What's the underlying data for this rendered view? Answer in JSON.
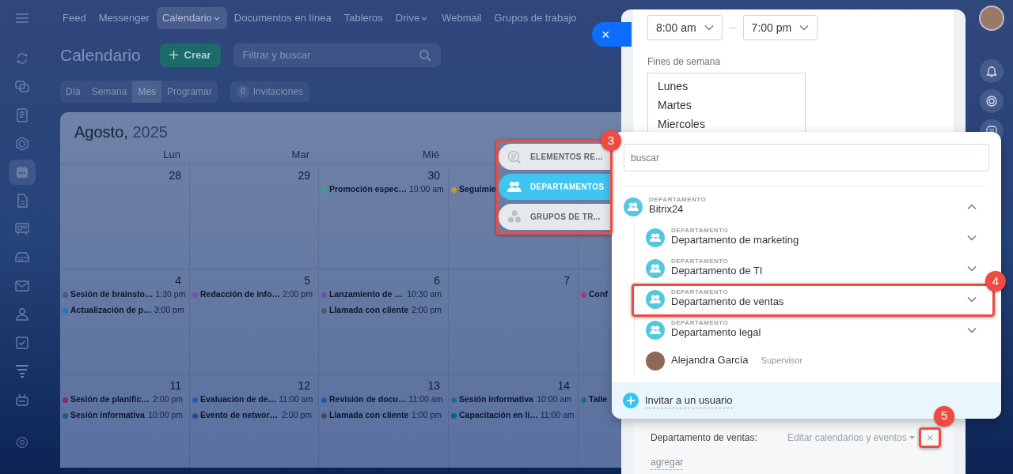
{
  "topnav": {
    "items": [
      {
        "label": "Feed",
        "selected": false,
        "dropdown": false
      },
      {
        "label": "Messenger",
        "selected": false,
        "dropdown": false
      },
      {
        "label": "Calendario",
        "selected": true,
        "dropdown": true
      },
      {
        "label": "Documentos en línea",
        "selected": false,
        "dropdown": false
      },
      {
        "label": "Tableros",
        "selected": false,
        "dropdown": false
      },
      {
        "label": "Drive",
        "selected": false,
        "dropdown": true
      },
      {
        "label": "Webmail",
        "selected": false,
        "dropdown": false
      },
      {
        "label": "Grupos de trabajo",
        "selected": false,
        "dropdown": false
      }
    ]
  },
  "sidebar": {
    "items": [
      {
        "kind": "sync",
        "selected": false
      },
      {
        "kind": "chat",
        "selected": false
      },
      {
        "kind": "news",
        "selected": false
      },
      {
        "kind": "hexagon",
        "selected": false
      },
      {
        "kind": "calendar",
        "selected": true
      },
      {
        "kind": "document",
        "selected": false
      },
      {
        "kind": "board",
        "selected": false
      },
      {
        "kind": "drive",
        "selected": false
      },
      {
        "kind": "mail",
        "selected": false
      },
      {
        "kind": "people",
        "selected": false
      },
      {
        "kind": "task",
        "selected": false
      },
      {
        "kind": "funnel",
        "selected": false
      },
      {
        "kind": "robot",
        "selected": false
      },
      {
        "kind": "gear",
        "selected": false
      }
    ]
  },
  "header": {
    "title": "Calendario",
    "create_button": "Crear",
    "search": {
      "placeholder": "Filtrar y buscar"
    }
  },
  "view_tabs": [
    {
      "label": "Día",
      "selected": false
    },
    {
      "label": "Semana",
      "selected": false
    },
    {
      "label": "Mes",
      "selected": true
    },
    {
      "label": "Programar",
      "selected": false
    }
  ],
  "invitations": {
    "count": "0",
    "label": "Invitaciones"
  },
  "calendar": {
    "month": "Agosto,",
    "year": "2025",
    "weekdays": [
      "Lun",
      "Mar",
      "Mié"
    ],
    "weeks": [
      {
        "days": [
          {
            "date": "28"
          },
          {
            "date": "29"
          },
          {
            "date": "30",
            "events": [
              {
                "title": "Promoción espec…",
                "time": "10:00 am",
                "color": "#2fa58c"
              }
            ]
          },
          {
            "events": [
              {
                "title": "Seguimie",
                "color": "#c79a2e"
              }
            ]
          }
        ]
      },
      {
        "days": [
          {
            "date": "4",
            "events": [
              {
                "title": "Sesión de brainsto…",
                "time": "1:30 pm",
                "color": "#3d5f8c"
              },
              {
                "title": "Actualización de p…",
                "time": "3:00 pm",
                "color": "#1f74c4"
              }
            ]
          },
          {
            "date": "5",
            "events": [
              {
                "title": "Redacción de info…",
                "time": "2:00 pm",
                "color": "#7454b0"
              }
            ]
          },
          {
            "date": "6",
            "events": [
              {
                "title": "Lanzamiento de …",
                "time": "10:30 am",
                "color": "#6a4fb0"
              },
              {
                "title": "Llamada con cliente",
                "time": "2:00 pm",
                "color": "#5a5a5a"
              }
            ]
          },
          {
            "date": "7"
          },
          {
            "events": [
              {
                "title": "Conf",
                "color": "#9c3d7a"
              }
            ]
          }
        ]
      },
      {
        "days": [
          {
            "date": "11",
            "events": [
              {
                "title": "Sesión de planific…",
                "time": "2:00 pm",
                "color": "#7a3060"
              },
              {
                "title": "Sesión informativa",
                "time": "10:00 pm",
                "color": "#1f5a80"
              }
            ]
          },
          {
            "date": "12",
            "events": [
              {
                "title": "Evaluación de de…",
                "time": "11:00 am",
                "color": "#1f5fb0"
              },
              {
                "title": "Evento de networ…",
                "time": "2:00 pm",
                "color": "#1f4f90"
              }
            ]
          },
          {
            "date": "13",
            "events": [
              {
                "title": "Revisión de docu…",
                "time": "11:00 am",
                "color": "#1a5ca8"
              },
              {
                "title": "Llamada con cliente",
                "time": "1:00 pm",
                "color": "#444a58"
              }
            ]
          },
          {
            "date": "14",
            "events": [
              {
                "title": "Sesión informativa",
                "time": "10:00 am",
                "color": "#1f6a8a"
              },
              {
                "title": "Capacitación en li…",
                "time": "11:00 am",
                "color": "#0f5f8f"
              }
            ]
          },
          {
            "events": [
              {
                "title": "Talle",
                "color": "#1f6a8a"
              }
            ]
          }
        ]
      }
    ]
  },
  "slider": {
    "close": "×",
    "time_from": "8:00 am",
    "time_to": "7:00 pm",
    "weekends_label": "Fines de semana",
    "weekend_options": [
      "Lunes",
      "Martes",
      "Miercoles"
    ],
    "access_row": {
      "name": "Departamento de ventas:",
      "permission": "Editar calendarios y eventos",
      "remove": "×",
      "callout": "5"
    },
    "add_link": "agregar"
  },
  "entity_selector": {
    "tabs_callout": "3",
    "tabs": [
      {
        "label": "ELEMENTOS RE...",
        "kind": "recent",
        "selected": false
      },
      {
        "label": "DEPARTAMENTOS",
        "kind": "departments",
        "selected": true
      },
      {
        "label": "GRUPOS DE TR...",
        "kind": "groups",
        "selected": false
      }
    ],
    "search": {
      "placeholder": "buscar"
    },
    "tree": [
      {
        "kind": "department",
        "type_label": "DEPARTAMENTO",
        "name": "Bitrix24",
        "expanded": true,
        "children": [
          {
            "kind": "department",
            "type_label": "DEPARTAMENTO",
            "name": "Departamento de marketing",
            "expanded": false
          },
          {
            "kind": "department",
            "type_label": "DEPARTAMENTO",
            "name": "Departamento de TI",
            "expanded": false
          },
          {
            "kind": "department",
            "type_label": "DEPARTAMENTO",
            "name": "Departamento de ventas",
            "expanded": false,
            "callout": "4"
          },
          {
            "kind": "department",
            "type_label": "DEPARTAMENTO",
            "name": "Departamento legal",
            "expanded": false
          },
          {
            "kind": "user",
            "name": "Alejandra García",
            "role": "Supervisor"
          }
        ]
      }
    ],
    "footer": "Invitar a un usuario"
  }
}
